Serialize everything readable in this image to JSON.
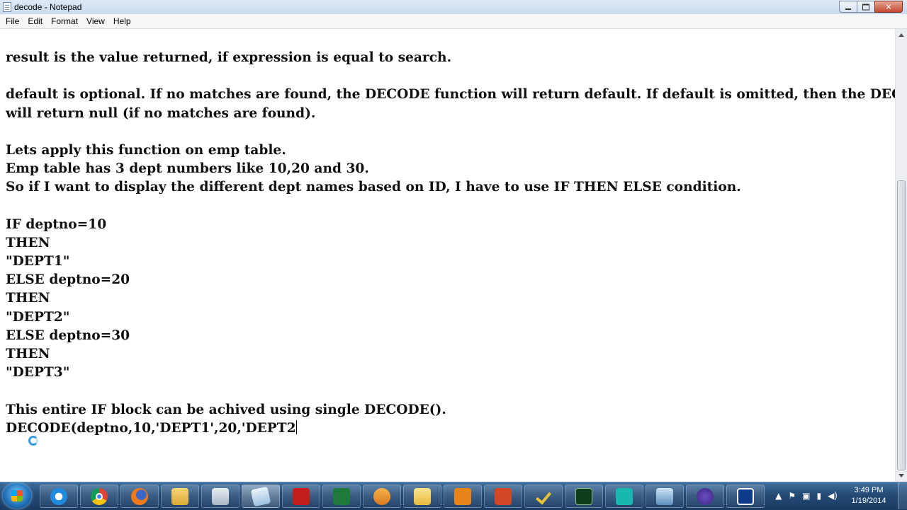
{
  "window": {
    "title": "decode - Notepad"
  },
  "menu": [
    "File",
    "Edit",
    "Format",
    "View",
    "Help"
  ],
  "document": {
    "lines": [
      "result is the value returned, if expression is equal to search.",
      "",
      "default is optional. If no matches are found, the DECODE function will return default. If default is omitted, then the DECODE function",
      "will return null (if no matches are found).",
      "",
      "Lets apply this function on emp table.",
      "Emp table has 3 dept numbers like 10,20 and 30.",
      "So if I want to display the different dept names based on ID, I have to use IF THEN ELSE condition.",
      "",
      "IF deptno=10",
      "THEN",
      "\"DEPT1\"",
      "ELSE deptno=20",
      "THEN",
      "\"DEPT2\"",
      "ELSE deptno=30",
      "THEN",
      "\"DEPT3\"",
      "",
      "This entire IF block can be achived using single DECODE().",
      "DECODE(deptno,10,'DEPT1',20,'DEPT2"
    ]
  },
  "taskbar": {
    "apps": [
      {
        "icon": "internet-explorer-icon",
        "cls": "ie-icon"
      },
      {
        "icon": "chrome-icon",
        "cls": "chrome-icon"
      },
      {
        "icon": "firefox-icon",
        "cls": "firefox-icon"
      },
      {
        "icon": "windows-explorer-icon",
        "cls": "explorer-icon"
      },
      {
        "icon": "calculator-icon",
        "cls": "calculator-icon"
      },
      {
        "icon": "notepad-icon",
        "cls": "notepad-icon",
        "active": true
      },
      {
        "icon": "acrobat-icon",
        "cls": "acrobat-icon"
      },
      {
        "icon": "excel-icon",
        "cls": "excel-icon"
      },
      {
        "icon": "media-player-icon",
        "cls": "media-icon"
      },
      {
        "icon": "folder-icon",
        "cls": "folder-icon"
      },
      {
        "icon": "outlook-icon",
        "cls": "outlook-icon"
      },
      {
        "icon": "powerpoint-icon",
        "cls": "powerpoint-icon"
      },
      {
        "icon": "checkmark-app-icon",
        "cls": "check-icon"
      },
      {
        "icon": "command-console-icon",
        "cls": "console-icon"
      },
      {
        "icon": "monitor-icon",
        "cls": "monitor-icon"
      },
      {
        "icon": "remote-desktop-icon",
        "cls": "remote-icon"
      },
      {
        "icon": "torrent-icon",
        "cls": "torrent-icon"
      },
      {
        "icon": "snipping-tool-icon",
        "cls": "snip-icon"
      }
    ],
    "clock": {
      "time": "3:49 PM",
      "date": "1/19/2014"
    }
  }
}
